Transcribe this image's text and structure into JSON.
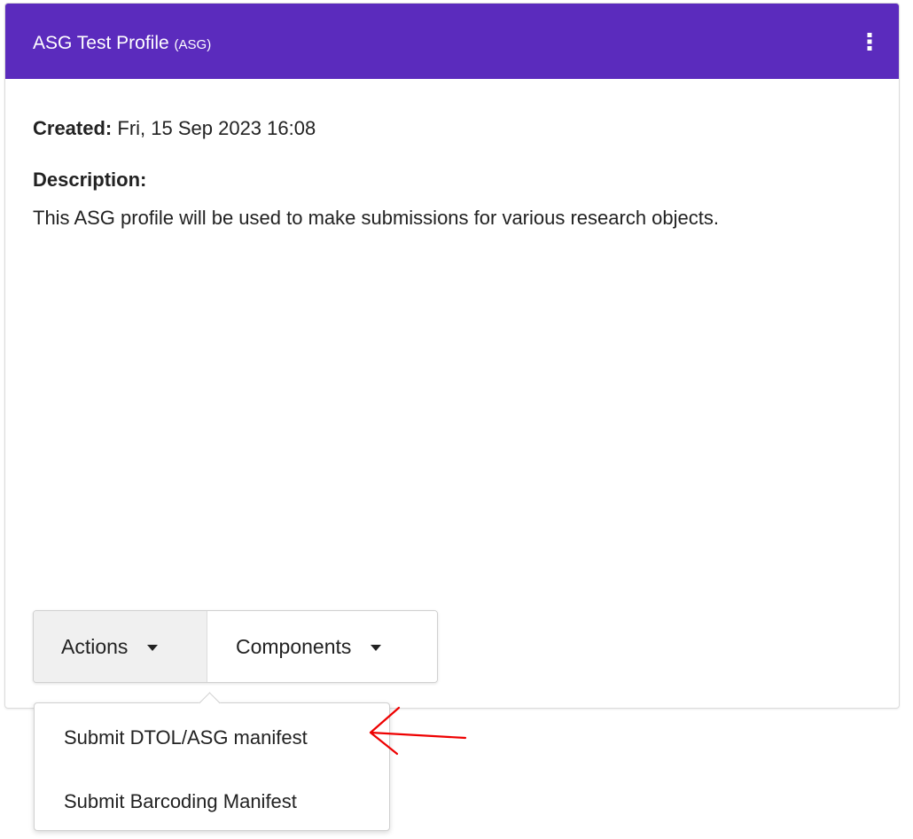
{
  "theme": {
    "accent": "#5b2bbd",
    "annotation_color": "#ee0000"
  },
  "profile": {
    "title": "ASG Test Profile",
    "type_tag": "(ASG)",
    "menu_icon": "kebab-vertical-icon",
    "created_label": "Created:",
    "created_value": "Fri, 15 Sep 2023 16:08",
    "description_label": "Description:",
    "description_text": "This ASG profile will be used to make submissions for various research objects."
  },
  "buttons": {
    "actions_label": "Actions",
    "components_label": "Components"
  },
  "actions_menu": {
    "items": [
      {
        "label": "Submit DTOL/ASG manifest"
      },
      {
        "label": "Submit Barcoding Manifest"
      }
    ]
  },
  "annotation": {
    "icon": "red-arrow-icon"
  }
}
